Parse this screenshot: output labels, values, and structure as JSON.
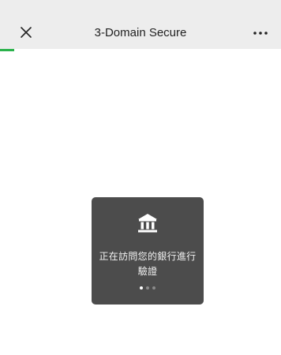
{
  "nav": {
    "title": "3-Domain Secure",
    "close_icon": "close-icon",
    "more_icon": "more-dots-icon"
  },
  "progress": {
    "value_percent": 5,
    "color": "#2bb24c"
  },
  "loading_toast": {
    "icon": "bank-icon",
    "message": "正在訪問您的銀行進行驗證",
    "dots_total": 3,
    "dots_active_index": 0
  },
  "colors": {
    "nav_background": "#ededed",
    "toast_background": "#4c4c4c"
  }
}
